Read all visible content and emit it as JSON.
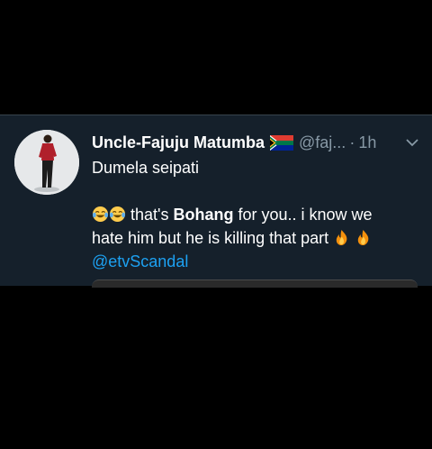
{
  "tweet": {
    "display_name": "Uncle-Fajuju Matumba",
    "handle": "@faj...",
    "separator": "·",
    "time": "1h",
    "line1": "Dumela seipati",
    "line2_pre": " that's ",
    "line2_bold": "Bohang",
    "line2_post": " for you.. i know we",
    "line3": "hate him but he is killing that part ",
    "mention": "@etvScandal",
    "icons": [
      "avatar-photo",
      "south-africa-flag-icon",
      "chevron-down-icon",
      "tears-of-joy-emoji",
      "fire-emoji"
    ]
  },
  "colors": {
    "background": "#000000",
    "card": "#15202b",
    "secondary_text": "#8899a6",
    "link": "#1da1f2"
  }
}
